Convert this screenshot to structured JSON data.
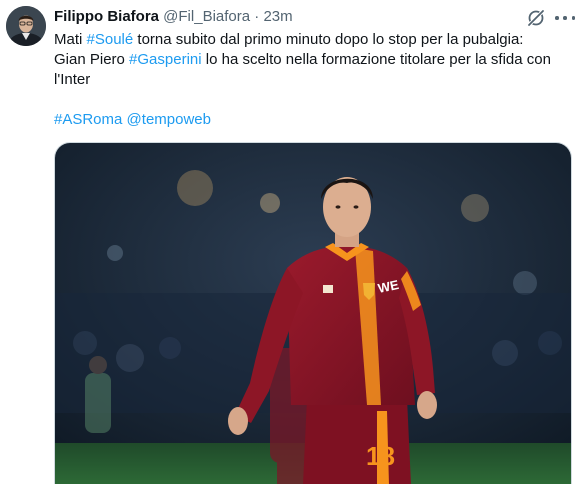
{
  "tweet": {
    "author_name": "Filippo Biafora",
    "author_handle": "@Fil_Biafora",
    "separator": "·",
    "time": "23m",
    "text_lines": [
      [
        {
          "t": "Mati ",
          "tag": false
        },
        {
          "t": "#Soulé",
          "tag": true
        },
        {
          "t": " torna subito dal primo minuto dopo lo stop per la pubalgia:",
          "tag": false
        }
      ],
      [
        {
          "t": "Gian Piero ",
          "tag": false
        },
        {
          "t": "#Gasperini",
          "tag": true
        },
        {
          "t": " lo ha scelto nella formazione titolare per la sfida con",
          "tag": false
        }
      ],
      [
        {
          "t": "l'Inter",
          "tag": false
        }
      ]
    ],
    "tags_line": {
      "hashtag": "#ASRoma",
      "mention": "@tempoweb"
    },
    "shirt_number": "18",
    "icons": {
      "grok": "grok-icon",
      "more": "more-icon"
    },
    "colors": {
      "link": "#1d9bf0",
      "secondary_text": "#536471",
      "jersey": "#8a1528",
      "accent": "#f7941d"
    }
  }
}
